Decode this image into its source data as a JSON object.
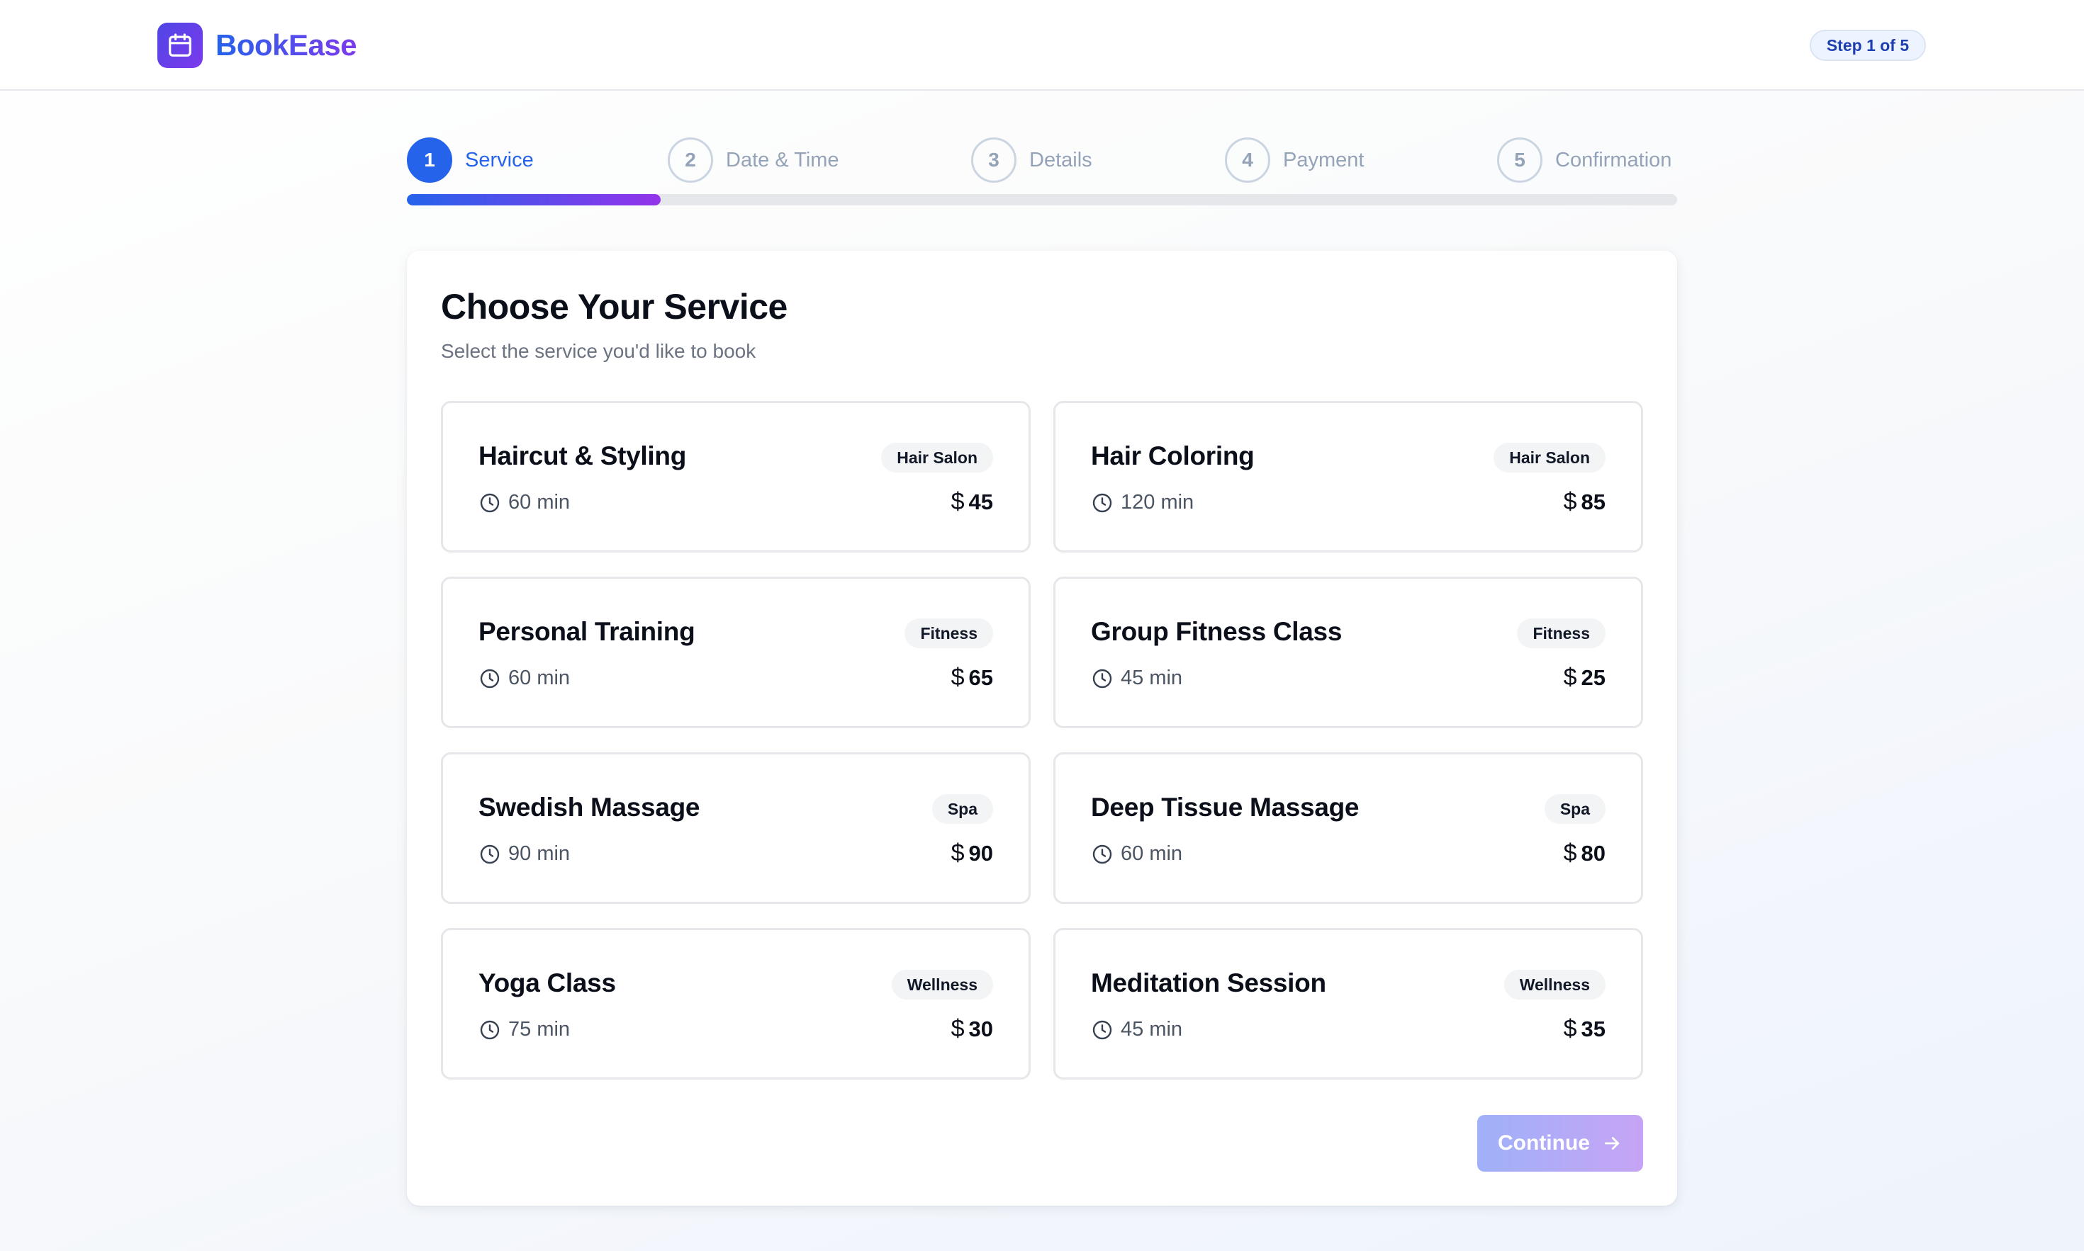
{
  "app": {
    "name": "BookEase",
    "logo_icon": "calendar-icon",
    "step_indicator": "Step 1 of 5"
  },
  "stepper": {
    "current_step": 1,
    "total_steps": 5,
    "progress_percent": 20,
    "steps": [
      {
        "number": "1",
        "label": "Service",
        "state": "active"
      },
      {
        "number": "2",
        "label": "Date & Time",
        "state": "upcoming"
      },
      {
        "number": "3",
        "label": "Details",
        "state": "upcoming"
      },
      {
        "number": "4",
        "label": "Payment",
        "state": "upcoming"
      },
      {
        "number": "5",
        "label": "Confirmation",
        "state": "upcoming"
      }
    ]
  },
  "main": {
    "title": "Choose Your Service",
    "subtitle": "Select the service you'd like to book",
    "services": [
      {
        "name": "Haircut & Styling",
        "category": "Hair Salon",
        "duration": "60 min",
        "price": "45",
        "currency_icon": "dollar-icon"
      },
      {
        "name": "Hair Coloring",
        "category": "Hair Salon",
        "duration": "120 min",
        "price": "85",
        "currency_icon": "dollar-icon"
      },
      {
        "name": "Personal Training",
        "category": "Fitness",
        "duration": "60 min",
        "price": "65",
        "currency_icon": "dollar-icon"
      },
      {
        "name": "Group Fitness Class",
        "category": "Fitness",
        "duration": "45 min",
        "price": "25",
        "currency_icon": "dollar-icon"
      },
      {
        "name": "Swedish Massage",
        "category": "Spa",
        "duration": "90 min",
        "price": "90",
        "currency_icon": "dollar-icon"
      },
      {
        "name": "Deep Tissue Massage",
        "category": "Spa",
        "duration": "60 min",
        "price": "80",
        "currency_icon": "dollar-icon"
      },
      {
        "name": "Yoga Class",
        "category": "Wellness",
        "duration": "75 min",
        "price": "30",
        "currency_icon": "dollar-icon"
      },
      {
        "name": "Meditation Session",
        "category": "Wellness",
        "duration": "45 min",
        "price": "35",
        "currency_icon": "dollar-icon"
      }
    ],
    "continue_label": "Continue",
    "continue_icon": "arrow-right-icon",
    "continue_enabled": false
  },
  "colors": {
    "accent": "#2563eb",
    "brand_gradient_start": "#4f46e5",
    "brand_gradient_end": "#7c3aed",
    "inactive": "#94a3b8",
    "continue_disabled_start": "#9fb1f9",
    "continue_disabled_end": "#c7a4f5"
  }
}
